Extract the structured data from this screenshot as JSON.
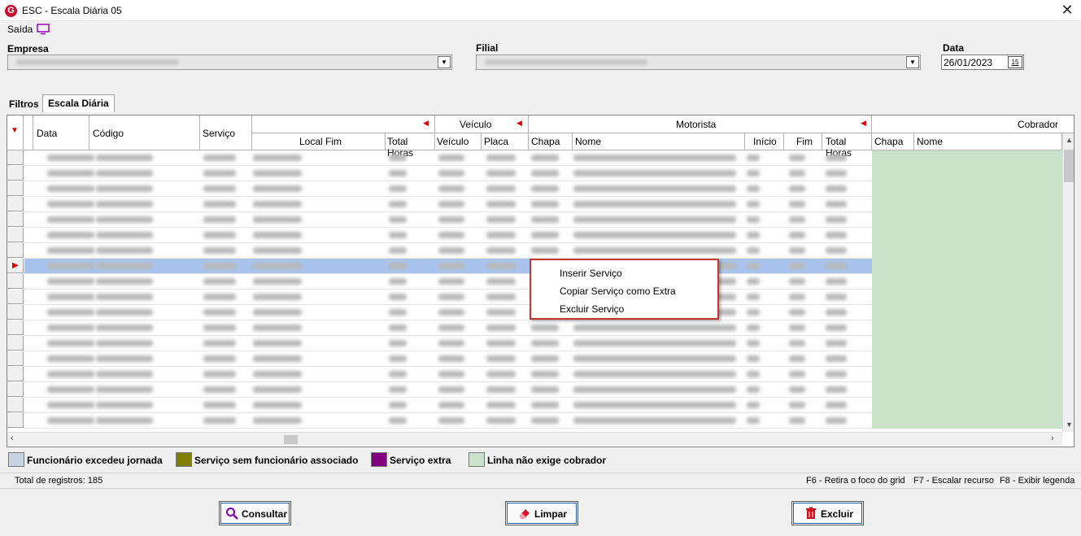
{
  "window": {
    "title": "ESC - Escala Diária 05",
    "close_glyph": "✕",
    "logo_letter": "G"
  },
  "menu": {
    "saida": "Saída"
  },
  "filters": {
    "empresa_label": "Empresa",
    "filial_label": "Filial",
    "data_label": "Data",
    "data_value": "26/01/2023",
    "cal_btn": "15"
  },
  "tabs": [
    {
      "label": "Filtros"
    },
    {
      "label": "Escala Diária"
    }
  ],
  "grid": {
    "groups": {
      "veiculo": "Veículo",
      "motorista": "Motorista",
      "cobrador": "Cobrador"
    },
    "columns": {
      "data": "Data",
      "codigo": "Código",
      "servico": "Serviço",
      "local_fim": "Local Fim",
      "total_horas": "Total Horas",
      "veiculo": "Veículo",
      "placa": "Placa",
      "m_chapa": "Chapa",
      "m_nome": "Nome",
      "inicio": "Início",
      "fim": "Fim",
      "m_total_horas": "Total Horas",
      "c_chapa": "Chapa",
      "c_nome": "Nome"
    },
    "selected_row_marker": "▶"
  },
  "context_menu": {
    "items": [
      "Inserir Serviço",
      "Copiar Serviço como Extra",
      "Excluir Serviço"
    ]
  },
  "legend": [
    {
      "label": "Funcionário excedeu jornada",
      "color": "#c5d3e3"
    },
    {
      "label": "Serviço sem funcionário associado",
      "color": "#808000"
    },
    {
      "label": "Serviço extra",
      "color": "#800080"
    },
    {
      "label": "Linha não exige cobrador",
      "color": "#c8e3c9"
    }
  ],
  "status": {
    "total": "Total de registros: 185",
    "f6": "F6 - Retira o foco do grid",
    "f7": "F7 - Escalar recurso",
    "f8": "F8 - Exibir legenda"
  },
  "buttons": {
    "consultar": "Consultar",
    "limpar": "Limpar",
    "excluir": "Excluir"
  }
}
